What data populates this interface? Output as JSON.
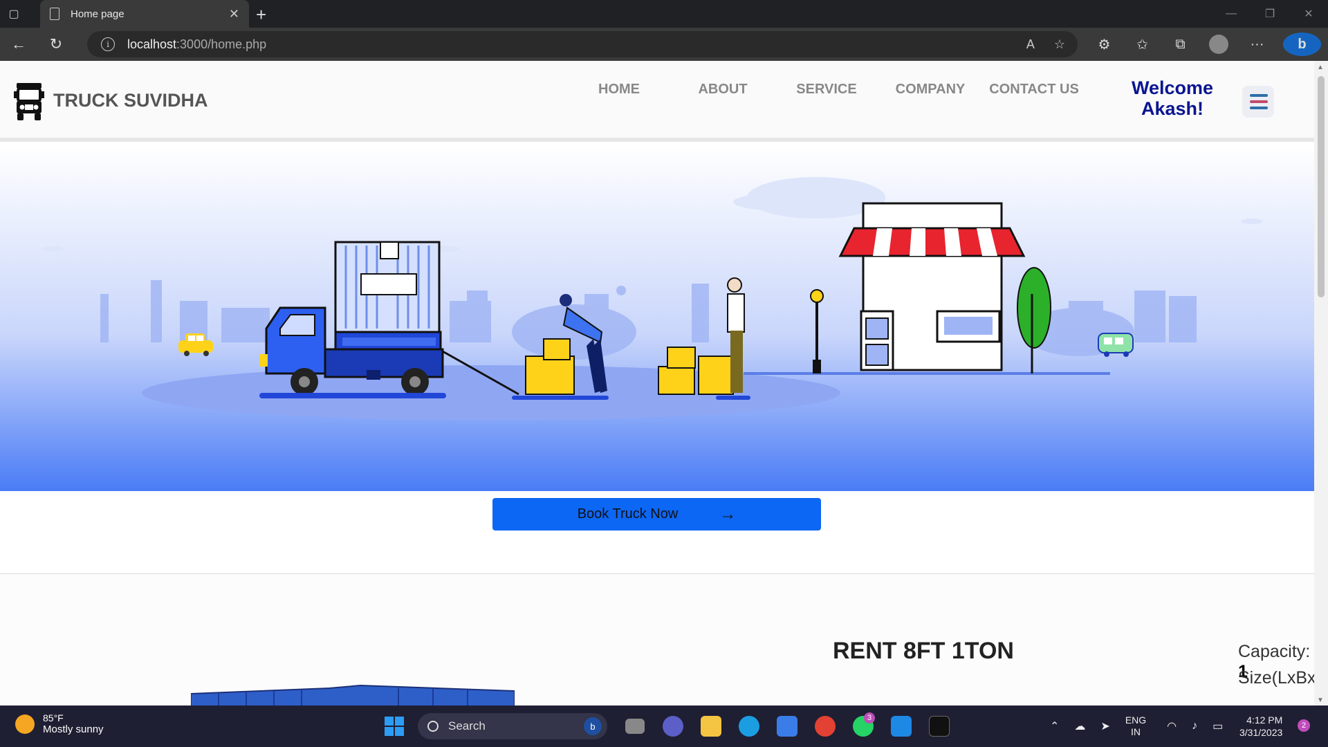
{
  "browser": {
    "tab_title": "Home page",
    "url_host": "localhost",
    "url_path": ":3000/home.php"
  },
  "site": {
    "brand": "TRUCK SUVIDHA",
    "menu": [
      "HOME",
      "ABOUT",
      "SERVICE",
      "COMPANY",
      "CONTACT US"
    ],
    "welcome": "Welcome Akash!"
  },
  "hero": {
    "book_button": "Book Truck Now",
    "arrow": "→"
  },
  "listing": {
    "title": "RENT 8FT 1TON",
    "capacity_label": "Capacity:",
    "capacity_value": "1",
    "size_label": "Size(LxBxH"
  },
  "taskbar": {
    "temperature": "85°F",
    "condition": "Mostly sunny",
    "search_label": "Search",
    "whatsapp_badge": "3",
    "lang_line1": "ENG",
    "lang_line2": "IN",
    "time": "4:12 PM",
    "date": "3/31/2023",
    "notifications": "2"
  },
  "colors": {
    "accent": "#0d67f5",
    "welcome": "#0a1590",
    "hero_top": "#ffffff",
    "hero_bottom": "#4a7cf6"
  }
}
